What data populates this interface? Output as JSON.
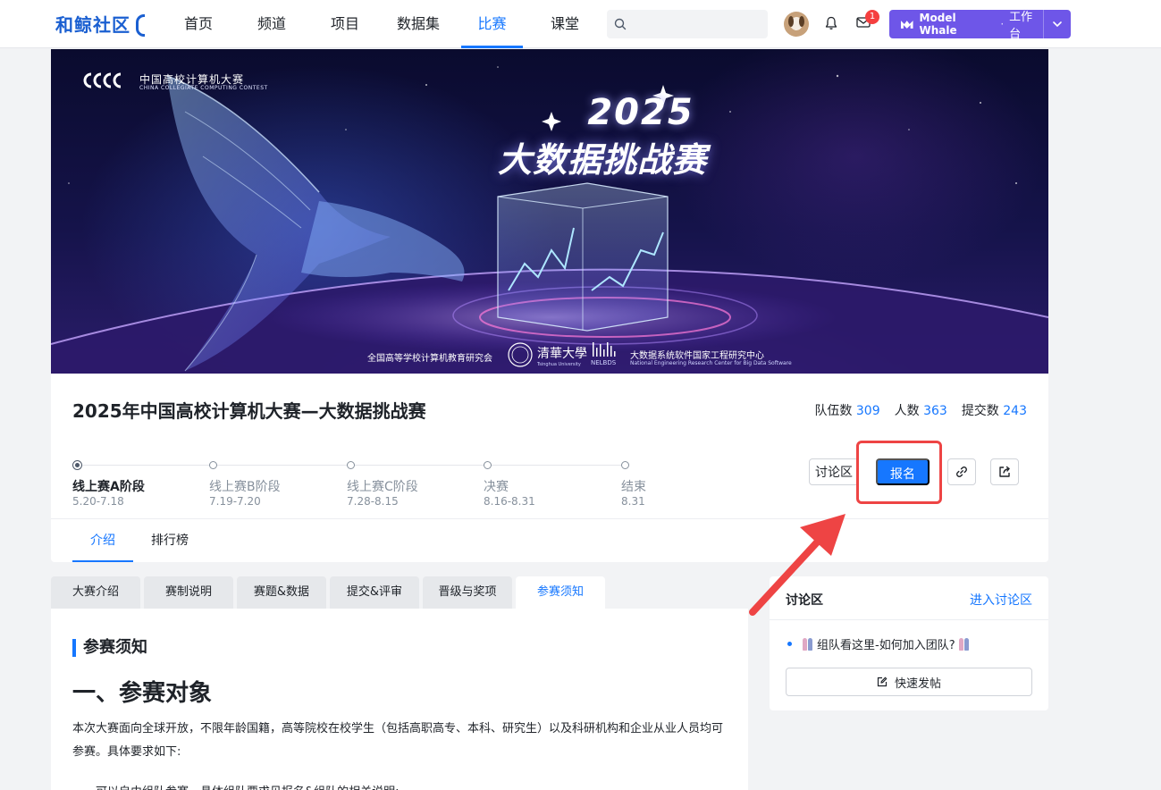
{
  "nav": {
    "logo": "和鲸社区",
    "items": [
      {
        "label": "首页"
      },
      {
        "label": "频道"
      },
      {
        "label": "项目"
      },
      {
        "label": "数据集"
      },
      {
        "label": "比赛"
      },
      {
        "label": "课堂"
      }
    ],
    "active_item": "比赛",
    "notification_count": "1",
    "workspace": {
      "brand": "Model Whale",
      "separator": "·",
      "label": "工作台"
    }
  },
  "banner": {
    "org_logo_text": "中国高校计算机大赛",
    "org_logo_sub": "CHINA COLLEGIATE COMPUTING CONTEST",
    "year": "2025",
    "title": "大数据挑战赛",
    "footer_org1": "全国高等学校计算机教育研究会",
    "footer_tsinghua": "清華大學",
    "footer_tsinghua_sub": "Tsinghua University",
    "footer_nel": "NELBDS",
    "footer_org2": "大数据系统软件国家工程研究中心",
    "footer_org2_sub": "National Engineering Research Center for Big Data Software"
  },
  "competition": {
    "title": "2025年中国高校计算机大赛—大数据挑战赛",
    "stats": [
      {
        "label": "队伍数",
        "value": "309"
      },
      {
        "label": "人数",
        "value": "363"
      },
      {
        "label": "提交数",
        "value": "243"
      }
    ],
    "stages": [
      {
        "name": "线上赛A阶段",
        "date": "5.20-7.18",
        "active": true
      },
      {
        "name": "线上赛B阶段",
        "date": "7.19-7.20",
        "active": false
      },
      {
        "name": "线上赛C阶段",
        "date": "7.28-8.15",
        "active": false
      },
      {
        "name": "决赛",
        "date": "8.16-8.31",
        "active": false
      },
      {
        "name": "结束",
        "date": "8.31",
        "active": false
      }
    ],
    "discussion_button": "讨论区",
    "signup_button": "报名",
    "tabs": [
      {
        "label": "介绍"
      },
      {
        "label": "排行榜"
      }
    ],
    "active_tab": "介绍"
  },
  "subtabs": [
    {
      "label": "大赛介绍"
    },
    {
      "label": "赛制说明"
    },
    {
      "label": "赛题&数据"
    },
    {
      "label": "提交&评审"
    },
    {
      "label": "晋级与奖项"
    },
    {
      "label": "参赛须知"
    }
  ],
  "active_subtab": "参赛须知",
  "content": {
    "section_title": "参赛须知",
    "heading": "一、参赛对象",
    "paragraph": "本次大赛面向全球开放，不限年龄国籍，高等院校在校学生（包括高职高专、本科、研究生）以及科研机构和企业从业人员均可参赛。具体要求如下:",
    "paragraph2": "可以自由组队参赛，具体组队要求见报名&组队的相关说明;"
  },
  "sidebar": {
    "title": "讨论区",
    "link": "进入讨论区",
    "items": [
      {
        "text": "组队看这里-如何加入团队?"
      }
    ],
    "post_button": "快速发帖"
  },
  "colors": {
    "accent": "#1677ff",
    "brand_purple": "#6e56e8",
    "annotation_red": "#ee4444"
  }
}
